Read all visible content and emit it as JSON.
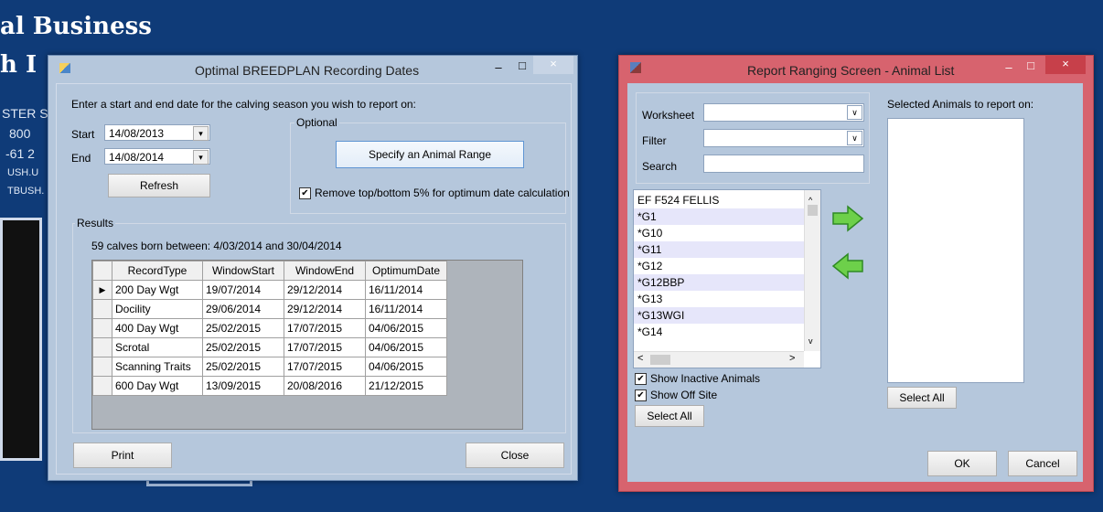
{
  "background": {
    "line1": "al Business",
    "line2": "h I",
    "lines": [
      "STER S",
      "800",
      "-61 2",
      "USH.U",
      "TBUSH."
    ]
  },
  "breedplan": {
    "title": "Optimal BREEDPLAN Recording Dates",
    "controls": {
      "minimize": "–",
      "maximize": "□",
      "close": "×"
    },
    "prompt": "Enter a start and end date for the calving season you wish to report on:",
    "start_label": "Start",
    "start_value": "14/08/2013",
    "end_label": "End",
    "end_value": "14/08/2014",
    "refresh": "Refresh",
    "optional_label": "Optional",
    "specify_range": "Specify an Animal Range",
    "remove_label": "Remove top/bottom 5% for optimum date calculation",
    "results_label": "Results",
    "summary": "59 calves born between: 4/03/2014 and 30/04/2014",
    "columns": [
      "RecordType",
      "WindowStart",
      "WindowEnd",
      "OptimumDate"
    ],
    "rows": [
      [
        "200 Day Wgt",
        "19/07/2014",
        "29/12/2014",
        "16/11/2014"
      ],
      [
        "Docility",
        "29/06/2014",
        "29/12/2014",
        "16/11/2014"
      ],
      [
        "400 Day Wgt",
        "25/02/2015",
        "17/07/2015",
        "04/06/2015"
      ],
      [
        "Scrotal",
        "25/02/2015",
        "17/07/2015",
        "04/06/2015"
      ],
      [
        "Scanning Traits",
        "25/02/2015",
        "17/07/2015",
        "04/06/2015"
      ],
      [
        "600 Day Wgt",
        "13/09/2015",
        "20/08/2016",
        "21/12/2015"
      ]
    ],
    "print": "Print",
    "close": "Close"
  },
  "ranging": {
    "title": "Report Ranging Screen - Animal List",
    "controls": {
      "minimize": "–",
      "maximize": "□",
      "close": "×"
    },
    "worksheet_label": "Worksheet",
    "filter_label": "Filter",
    "search_label": "Search",
    "animals": [
      "EF F524 FELLIS",
      "*G1",
      "*G10",
      "*G11",
      "*G12",
      "*G12BBP",
      "*G13",
      "*G13WGI",
      "*G14"
    ],
    "selected_label": "Selected Animals to report on:",
    "show_inactive": "Show Inactive Animals",
    "show_offsite": "Show Off Site",
    "select_all_left": "Select All",
    "select_all_right": "Select All",
    "ok": "OK",
    "cancel": "Cancel"
  }
}
